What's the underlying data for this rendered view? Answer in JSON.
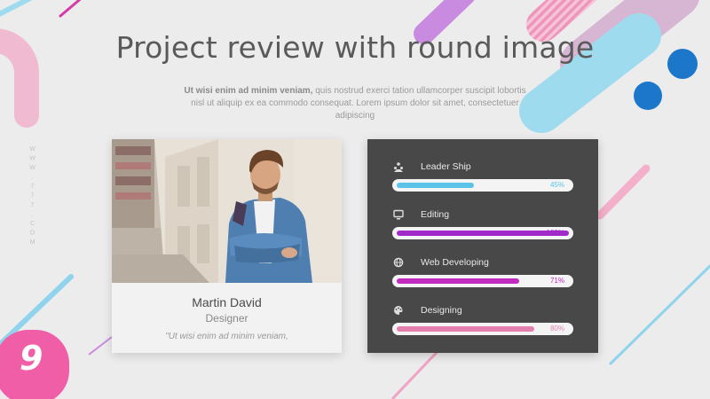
{
  "slide": {
    "title": "Project review with round image",
    "subtitle_bold": "Ut wisi enim ad minim veniam,",
    "subtitle_rest": " quis nostrud exerci tation ullamcorper suscipit lobortis nisl ut aliquip ex ea commodo consequat. Lorem ipsum dolor sit amet, consectetuer adipiscing",
    "side_text": "WWW.777.COM",
    "page_number": "9"
  },
  "profile": {
    "name": "Martin David",
    "role": "Designer",
    "quote": "\"Ut wisi enim ad minim veniam,"
  },
  "skills": [
    {
      "label": "Leader Ship",
      "percent_label": "45%",
      "value": 45,
      "color": "#5bc3e8",
      "icon": "people-icon"
    },
    {
      "label": "Editing",
      "percent_label": "100%",
      "value": 100,
      "color": "#a12bc9",
      "icon": "monitor-icon"
    },
    {
      "label": "Web Developing",
      "percent_label": "71%",
      "value": 71,
      "color": "#c22bbf",
      "icon": "globe-icon"
    },
    {
      "label": "Designing",
      "percent_label": "80%",
      "value": 80,
      "color": "#e47fae",
      "icon": "palette-icon"
    }
  ],
  "colors": {
    "background": "#ececec",
    "panel": "#484848",
    "accent_pink": "#ea7fb4",
    "accent_cyan": "#9fdbee",
    "accent_purple": "#c98be0",
    "accent_blue": "#1c76c9"
  }
}
